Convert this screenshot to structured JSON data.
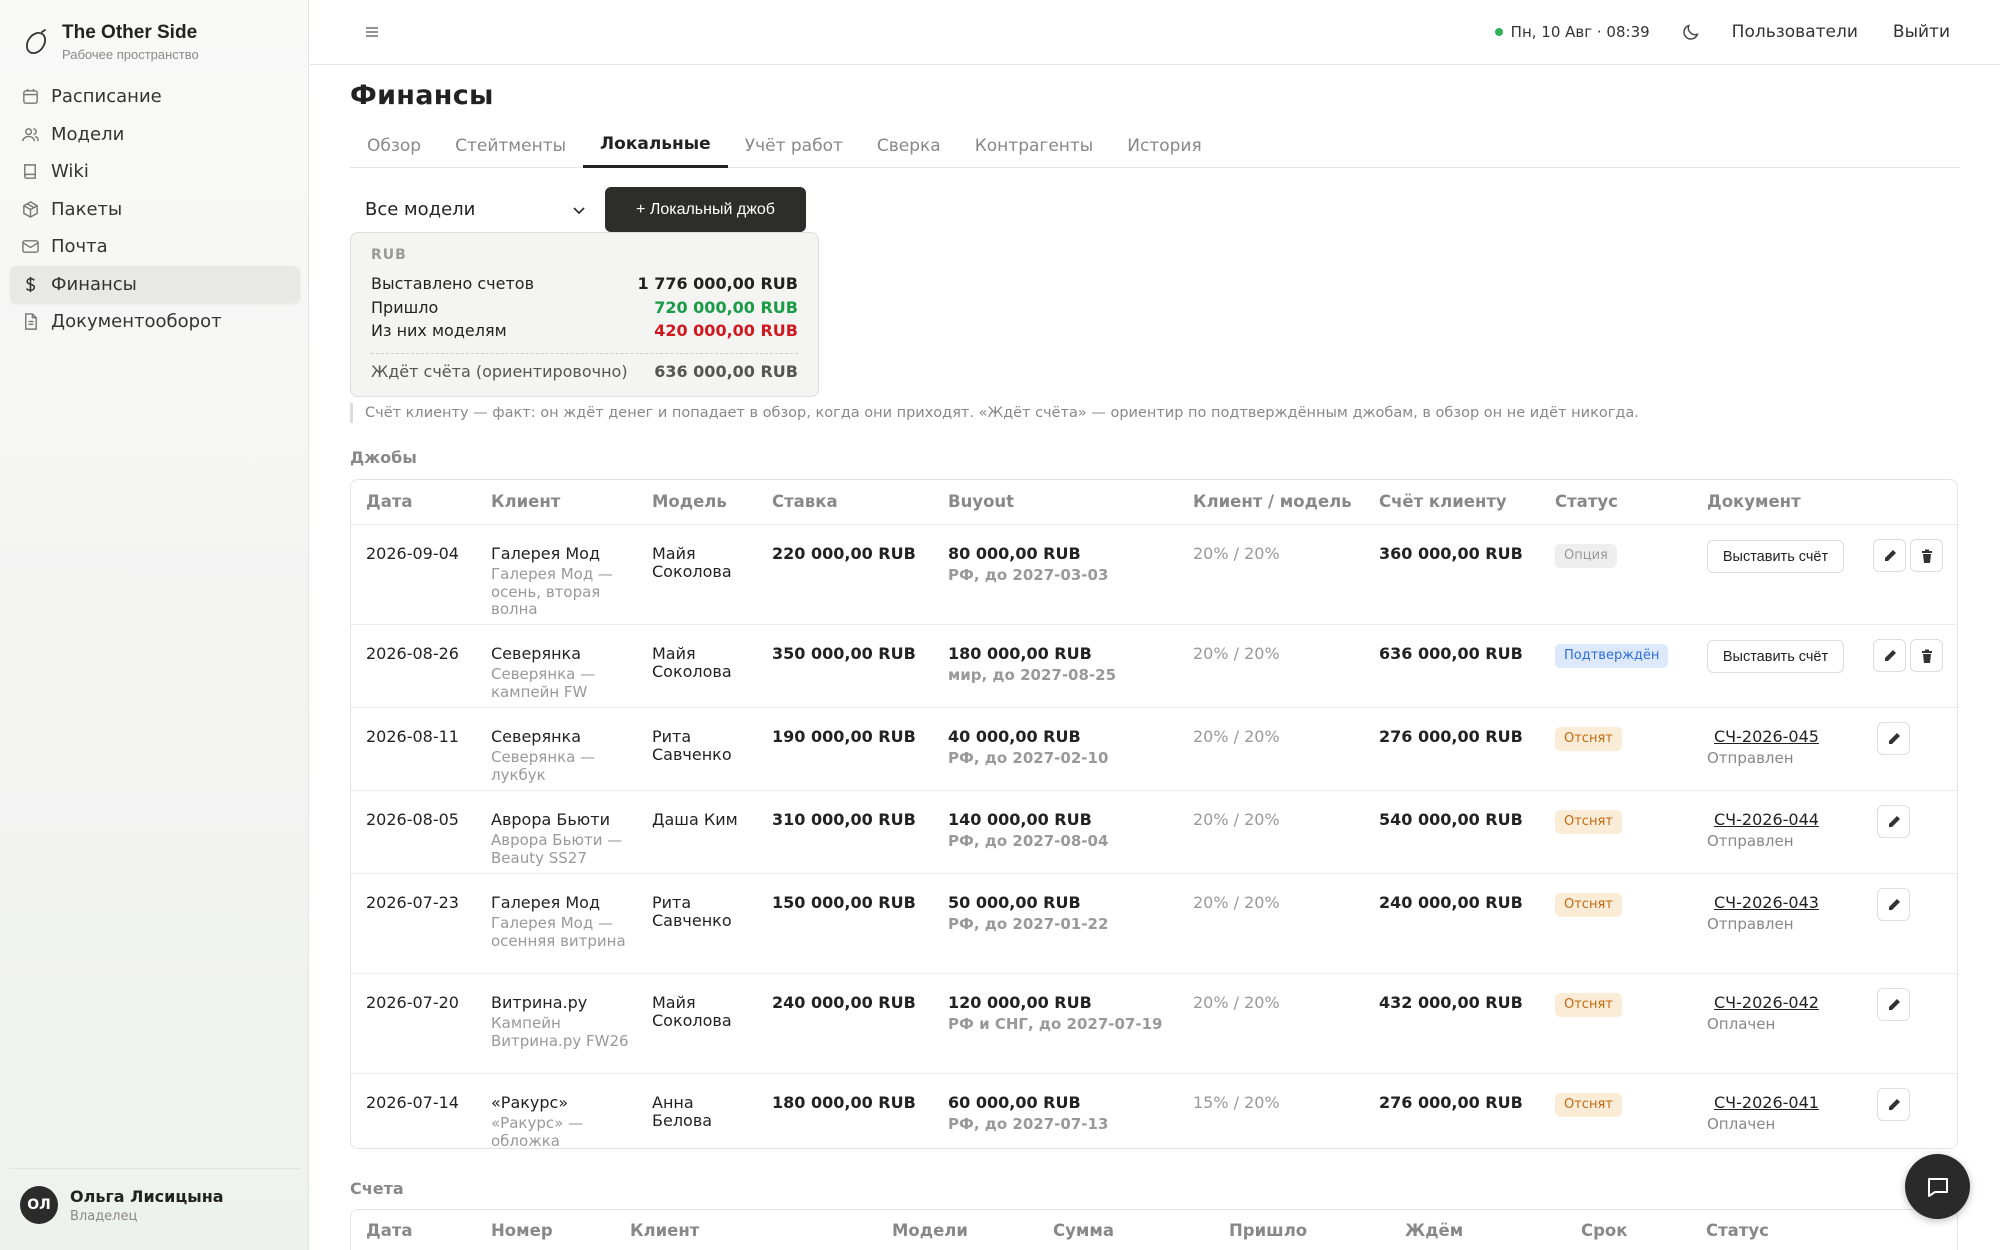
{
  "brand": {
    "title": "The Other Side",
    "subtitle": "Рабочее пространство"
  },
  "sidebar": {
    "items": [
      {
        "label": "Расписание",
        "icon": "calendar-icon"
      },
      {
        "label": "Модели",
        "icon": "users-icon"
      },
      {
        "label": "Wiki",
        "icon": "book-icon"
      },
      {
        "label": "Пакеты",
        "icon": "package-icon"
      },
      {
        "label": "Почта",
        "icon": "mail-icon"
      },
      {
        "label": "Финансы",
        "icon": "dollar-icon",
        "active": true
      },
      {
        "label": "Документооборот",
        "icon": "document-icon"
      }
    ],
    "user": {
      "initials": "ОЛ",
      "name": "Ольга Лисицына",
      "role": "Владелец"
    }
  },
  "topbar": {
    "datetime": "Пн, 10 Авг · 08:39",
    "users_label": "Пользователи",
    "logout_label": "Выйти"
  },
  "page": {
    "title": "Финансы",
    "tabs": [
      "Обзор",
      "Стейтменты",
      "Локальные",
      "Учёт работ",
      "Сверка",
      "Контрагенты",
      "История"
    ],
    "active_tab": "Локальные",
    "model_filter": "Все модели",
    "add_button": "+  Локальный джоб"
  },
  "summary": {
    "currency": "RUB",
    "invoiced_label": "Выставлено счетов",
    "invoiced_value": "1 776 000,00 RUB",
    "received_label": "Пришло",
    "received_value": "720 000,00 RUB",
    "to_models_label": "Из них моделям",
    "to_models_value": "420 000,00 RUB",
    "awaiting_label": "Ждёт счёта (ориентировочно)",
    "awaiting_value": "636 000,00 RUB"
  },
  "note": "Счёт клиенту — факт: он ждёт денег и попадает в обзор, когда они приходят. «Ждёт счёта» — ориентир по подтверждённым джобам, в обзор он не идёт никогда.",
  "jobs": {
    "section_title": "Джобы",
    "headers": {
      "date": "Дата",
      "client": "Клиент",
      "model": "Модель",
      "rate": "Ставка",
      "buyout": "Buyout",
      "split": "Клиент / модель",
      "invoice": "Счёт клиенту",
      "status": "Статус",
      "document": "Документ"
    },
    "invoice_button": "Выставить счёт",
    "rows": [
      {
        "date": "2026-09-04",
        "client": "Галерея Мод",
        "client_sub": "Галерея Мод — осень, вторая волна",
        "model": "Майя Соколова",
        "rate": "220 000,00 RUB",
        "buyout": "80 000,00 RUB",
        "buyout_sub": "РФ, до 2027-03-03",
        "split": "20% / 20%",
        "invoice": "360 000,00 RUB",
        "status": "Опция",
        "status_kind": "option",
        "doc": "",
        "doc_status": ""
      },
      {
        "date": "2026-08-26",
        "client": "Северянка",
        "client_sub": "Северянка — кампейн FW",
        "model": "Майя Соколова",
        "rate": "350 000,00 RUB",
        "buyout": "180 000,00 RUB",
        "buyout_sub": "мир, до 2027-08-25",
        "split": "20% / 20%",
        "invoice": "636 000,00 RUB",
        "status": "Подтверждён",
        "status_kind": "confirmed",
        "doc": "",
        "doc_status": ""
      },
      {
        "date": "2026-08-11",
        "client": "Северянка",
        "client_sub": "Северянка — лукбук",
        "model": "Рита Савченко",
        "rate": "190 000,00 RUB",
        "buyout": "40 000,00 RUB",
        "buyout_sub": "РФ, до 2027-02-10",
        "split": "20% / 20%",
        "invoice": "276 000,00 RUB",
        "status": "Отснят",
        "status_kind": "shot",
        "doc": "СЧ-2026-045",
        "doc_status": "Отправлен"
      },
      {
        "date": "2026-08-05",
        "client": "Аврора Бьюти",
        "client_sub": "Аврора Бьюти — Beauty SS27",
        "model": "Даша Ким",
        "rate": "310 000,00 RUB",
        "buyout": "140 000,00 RUB",
        "buyout_sub": "РФ, до 2027-08-04",
        "split": "20% / 20%",
        "invoice": "540 000,00 RUB",
        "status": "Отснят",
        "status_kind": "shot",
        "doc": "СЧ-2026-044",
        "doc_status": "Отправлен"
      },
      {
        "date": "2026-07-23",
        "client": "Галерея Мод",
        "client_sub": "Галерея Мод — осенняя витрина",
        "model": "Рита Савченко",
        "rate": "150 000,00 RUB",
        "buyout": "50 000,00 RUB",
        "buyout_sub": "РФ, до 2027-01-22",
        "split": "20% / 20%",
        "invoice": "240 000,00 RUB",
        "status": "Отснят",
        "status_kind": "shot",
        "doc": "СЧ-2026-043",
        "doc_status": "Отправлен"
      },
      {
        "date": "2026-07-20",
        "client": "Витрина.ру",
        "client_sub": "Кампейн Витрина.ру FW26",
        "model": "Майя Соколова",
        "rate": "240 000,00 RUB",
        "buyout": "120 000,00 RUB",
        "buyout_sub": "РФ и СНГ, до 2027-07-19",
        "split": "20% / 20%",
        "invoice": "432 000,00 RUB",
        "status": "Отснят",
        "status_kind": "shot",
        "doc": "СЧ-2026-042",
        "doc_status": "Оплачен"
      },
      {
        "date": "2026-07-14",
        "client": "«Ракурс»",
        "client_sub": "«Ракурс» — обложка",
        "model": "Анна Белова",
        "rate": "180 000,00 RUB",
        "buyout": "60 000,00 RUB",
        "buyout_sub": "РФ, до 2027-07-13",
        "split": "15% / 20%",
        "invoice": "276 000,00 RUB",
        "status": "Отснят",
        "status_kind": "shot",
        "doc": "СЧ-2026-041",
        "doc_status": "Оплачен"
      }
    ]
  },
  "invoices": {
    "section_title": "Счета",
    "headers": [
      "Дата",
      "Номер",
      "Клиент",
      "Модели",
      "Сумма",
      "Пришло",
      "Ждём",
      "Срок",
      "Статус"
    ]
  },
  "colors": {
    "accent_dark": "#2d2d2b",
    "green": "#1a9b46",
    "red": "#d0191e",
    "online": "#2fb35a"
  }
}
